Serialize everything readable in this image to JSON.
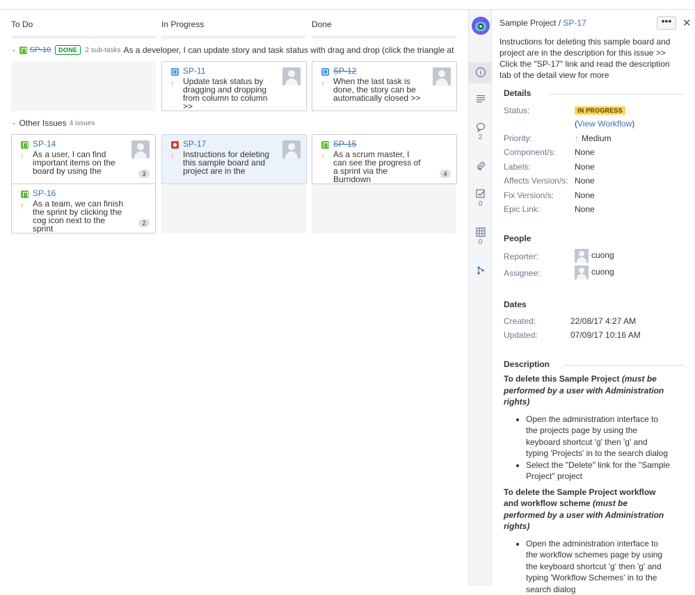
{
  "board": {
    "columns": [
      "To Do",
      "In Progress",
      "Done"
    ],
    "swimlane": {
      "key": "SP-10",
      "status": "DONE",
      "subtasks": "2 sub-tasks",
      "summary": "As a developer, I can update story and task status with drag and drop (click the triangle at far"
    },
    "cards_swimlane": [
      {
        "key": "SP-11",
        "summary": "Update task status by dragging and dropping from column to column >>"
      },
      {
        "key": "SP-12",
        "summary": "When the last task is done, the story can be automatically closed >>"
      }
    ],
    "other": {
      "label": "Other Issues",
      "count": "4 issues"
    },
    "cards_other": [
      {
        "key": "SP-14",
        "summary": "As a user, I can find important items on the board by using the",
        "badge": "3"
      },
      {
        "key": "SP-17",
        "summary": "Instructions for deleting this sample board and project are in the"
      },
      {
        "key": "SP-15",
        "summary": "As a scrum master, I can see the progress of a sprint via the Burndown",
        "badge": "4"
      },
      {
        "key": "SP-16",
        "summary": "As a team, we can finish the sprint by clicking the cog icon next to the sprint",
        "badge": "2"
      }
    ]
  },
  "detail": {
    "project": "Sample Project",
    "separator": "/",
    "issue_key": "SP-17",
    "more": "•••",
    "close": "✕",
    "title": "Instructions for deleting this sample board and project are in the description for this issue >> Click the \"SP-17\" link and read the description tab of the detail view for more",
    "rail": {
      "comments_count": "2",
      "subtasks_count": "0",
      "table_count": "0"
    },
    "details": {
      "heading": "Details",
      "status_label": "Status:",
      "status": "IN PROGRESS",
      "workflow_open": "(",
      "workflow_link": "View Workflow",
      "workflow_close": ")",
      "priority_label": "Priority:",
      "priority": "Medium",
      "components_label": "Component/s:",
      "components": "None",
      "labels_label": "Labels:",
      "labels": "None",
      "affects_label": "Affects Version/s:",
      "affects": "None",
      "fix_label": "Fix Version/s:",
      "fix": "None",
      "epic_label": "Epic Link:",
      "epic": "None"
    },
    "people": {
      "heading": "People",
      "reporter_label": "Reporter:",
      "reporter": "cuong",
      "assignee_label": "Assignee:",
      "assignee": "cuong"
    },
    "dates": {
      "heading": "Dates",
      "created_label": "Created:",
      "created": "22/08/17 4:27 AM",
      "updated_label": "Updated:",
      "updated": "07/09/17 10:16 AM"
    },
    "description": {
      "heading": "Description",
      "h1_bold": "To delete this Sample Project ",
      "h1_italic": "(must be performed by a user with Administration rights)",
      "list1": [
        "Open the administration interface to the projects page by using the keyboard shortcut 'g' then 'g' and typing 'Projects' in to the search dialog",
        "Select the \"Delete\" link for the \"Sample Project\" project"
      ],
      "h2_bold": "To delete the Sample Project workflow and workflow scheme ",
      "h2_italic": "(must be performed by a user with Administration rights)",
      "list2": [
        "Open the administration interface to the workflow schemes page by using the keyboard shortcut 'g' then 'g' and typing 'Workflow Schemes' in to the search dialog"
      ]
    }
  }
}
